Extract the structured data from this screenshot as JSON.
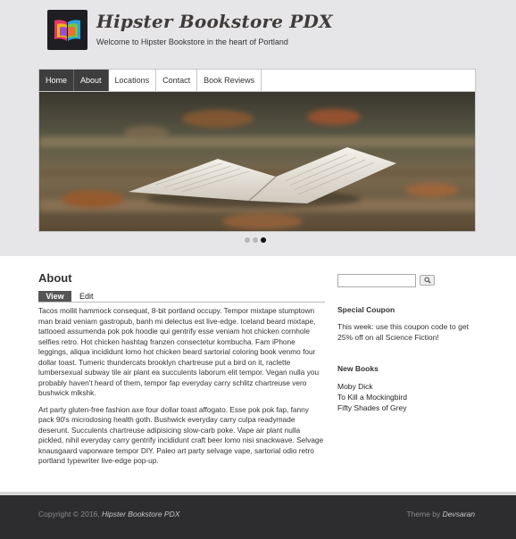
{
  "header": {
    "site_name": "Hipster Bookstore PDX",
    "slogan": "Welcome to Hipster Bookstore in the heart of Portland"
  },
  "nav": {
    "items": [
      {
        "label": "Home",
        "active": true
      },
      {
        "label": "About",
        "active": true
      },
      {
        "label": "Locations",
        "active": false
      },
      {
        "label": "Contact",
        "active": false
      },
      {
        "label": "Book Reviews",
        "active": false
      }
    ]
  },
  "slideshow": {
    "slide_count": 3,
    "current_slide": 3
  },
  "content": {
    "title": "About",
    "tabs": [
      {
        "label": "View",
        "active": true
      },
      {
        "label": "Edit",
        "active": false
      }
    ],
    "paragraphs": [
      "Tacos mollit hammock consequat, 8-bit portland occupy. Tempor mixtape stumptown man braid veniam gastropub, banh mi delectus est live-edge. Iceland beard mixtape, tattooed assumenda pok pok hoodie qui gentrify esse veniam hot chicken cornhole selfies retro. Hot chicken hashtag franzen consectetur kombucha. Fam iPhone leggings, aliqua incididunt lomo hot chicken beard sartorial coloring book venmo four dollar toast. Tumeric thundercats brooklyn chartreuse put a bird on it, raclette lumbersexual subway tile air plant ea succulents laborum elit tempor. Vegan nulla you probably haven't heard of them, tempor fap everyday carry schlitz chartreuse vero bushwick mlkshk.",
      "Art party gluten-free fashion axe four dollar toast affogato. Esse pok pok fap, fanny pack 90's microdosing health goth. Bushwick everyday carry culpa readymade deserunt. Succulents chartreuse adipisicing slow-carb poke. Vape air plant nulla pickled, nihil everyday carry gentrify incididunt craft beer lomo nisi snackwave. Selvage knausgaard vaporware tempor DIY. Paleo art party selvage vape, sartorial odio retro portland typewriter live-edge pop-up."
    ]
  },
  "sidebar": {
    "search": {
      "value": "",
      "placeholder": ""
    },
    "coupon": {
      "title": "Special Coupon",
      "text": "This week: use this coupon code to get 25% off on all Science Fiction!"
    },
    "new_books": {
      "title": "New Books",
      "items": [
        "Moby Dick",
        "To Kill a Mockingbird",
        "Fifty Shades of Grey"
      ]
    }
  },
  "footer": {
    "copyright_prefix": "Copyright © 2016,",
    "copyright_site": "Hipster Bookstore PDX",
    "credit_prefix": "Theme by",
    "credit_author": "Devsaran"
  },
  "icons": {
    "logo": "book-logo-icon",
    "search": "magnifier-icon"
  }
}
